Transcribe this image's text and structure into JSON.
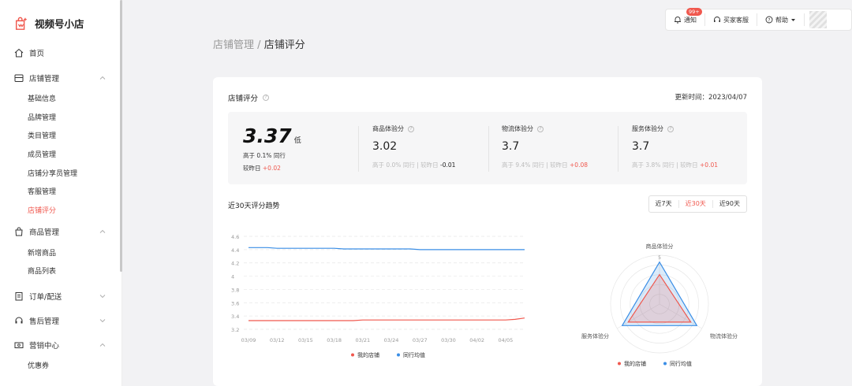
{
  "app": {
    "name": "视频号小店"
  },
  "sidebar": {
    "items": [
      {
        "label": "首页",
        "icon": "home-icon"
      },
      {
        "label": "店铺管理",
        "icon": "store-icon",
        "sub": [
          "基础信息",
          "品牌管理",
          "类目管理",
          "成员管理",
          "店铺分享员管理",
          "客服管理",
          "店铺评分"
        ]
      },
      {
        "label": "商品管理",
        "icon": "bag-icon",
        "sub": [
          "新增商品",
          "商品列表"
        ]
      },
      {
        "label": "订单/配送",
        "icon": "order-icon"
      },
      {
        "label": "售后管理",
        "icon": "headset-icon"
      },
      {
        "label": "营销中心",
        "icon": "coupon-icon",
        "sub": [
          "优惠券"
        ]
      }
    ],
    "active_sub": "店铺评分"
  },
  "topbar": {
    "notify": "通知",
    "badge": "99+",
    "service": "买家客服",
    "help": "帮助"
  },
  "breadcrumb": {
    "parent": "店铺管理",
    "sep": "/",
    "current": "店铺评分"
  },
  "card": {
    "title": "店铺评分",
    "updated": "更新时间：2023/04/07",
    "overall": {
      "score": "3.37",
      "level": "低",
      "line1": "高于 0.1% 同行",
      "line2_label": "较昨日",
      "line2_delta": "+0.02"
    },
    "subs": [
      {
        "label": "商品体验分",
        "value": "3.02",
        "pct": "高于 0.0% 同行",
        "cmp": "较昨日",
        "delta": "-0.01",
        "delta_color": "#222222"
      },
      {
        "label": "物流体验分",
        "value": "3.7",
        "pct": "高于 9.4% 同行",
        "cmp": "较昨日",
        "delta": "+0.08",
        "delta_color": "#f0584e"
      },
      {
        "label": "服务体验分",
        "value": "3.7",
        "pct": "高于 3.8% 同行",
        "cmp": "较昨日",
        "delta": "+0.01",
        "delta_color": "#f0584e"
      }
    ],
    "trend_title": "近30天评分趋势",
    "ranges": [
      "近7天",
      "近30天",
      "近90天"
    ],
    "active_range": "近30天"
  },
  "colors": {
    "accent": "#f0584e",
    "my_store": "#f0584e",
    "peer_avg": "#3a8ee6"
  },
  "chart_data": [
    {
      "type": "line",
      "x": [
        "03/09",
        "03/10",
        "03/11",
        "03/12",
        "03/13",
        "03/14",
        "03/15",
        "03/16",
        "03/17",
        "03/18",
        "03/19",
        "03/20",
        "03/21",
        "03/22",
        "03/23",
        "03/24",
        "03/25",
        "03/26",
        "03/27",
        "03/28",
        "03/29",
        "03/30",
        "03/31",
        "04/01",
        "04/02",
        "04/03",
        "04/04",
        "04/05",
        "04/06",
        "04/07"
      ],
      "x_ticks": [
        "03/09",
        "03/12",
        "03/15",
        "03/18",
        "03/21",
        "03/24",
        "03/27",
        "03/30",
        "04/02",
        "04/05"
      ],
      "y_ticks": [
        "4.6",
        "4.4",
        "4.2",
        "4",
        "3.8",
        "3.6",
        "3.4",
        "3.2"
      ],
      "ylim": [
        3.2,
        4.6
      ],
      "series": [
        {
          "name": "我的店铺",
          "color": "#f0584e",
          "values": [
            3.33,
            3.33,
            3.33,
            3.33,
            3.33,
            3.33,
            3.33,
            3.33,
            3.33,
            3.33,
            3.33,
            3.33,
            3.34,
            3.34,
            3.34,
            3.34,
            3.34,
            3.34,
            3.34,
            3.34,
            3.34,
            3.34,
            3.34,
            3.34,
            3.34,
            3.34,
            3.34,
            3.34,
            3.35,
            3.37
          ]
        },
        {
          "name": "同行均值",
          "color": "#3a8ee6",
          "values": [
            4.43,
            4.43,
            4.43,
            4.42,
            4.42,
            4.42,
            4.42,
            4.42,
            4.42,
            4.42,
            4.41,
            4.41,
            4.41,
            4.41,
            4.41,
            4.41,
            4.41,
            4.41,
            4.4,
            4.4,
            4.4,
            4.4,
            4.4,
            4.4,
            4.4,
            4.4,
            4.4,
            4.4,
            4.4,
            4.4
          ]
        }
      ],
      "legend": "bottom",
      "grid": true
    },
    {
      "type": "radar",
      "axes": [
        "商品体验分",
        "物流体验分",
        "服务体验分"
      ],
      "max": 5,
      "max_label": "5",
      "series": [
        {
          "name": "我的店铺",
          "color": "#f0584e",
          "values": [
            3.02,
            3.7,
            3.7
          ]
        },
        {
          "name": "同行均值",
          "color": "#3a8ee6",
          "values": [
            4.3,
            4.4,
            4.4
          ]
        }
      ],
      "legend": "bottom"
    }
  ]
}
